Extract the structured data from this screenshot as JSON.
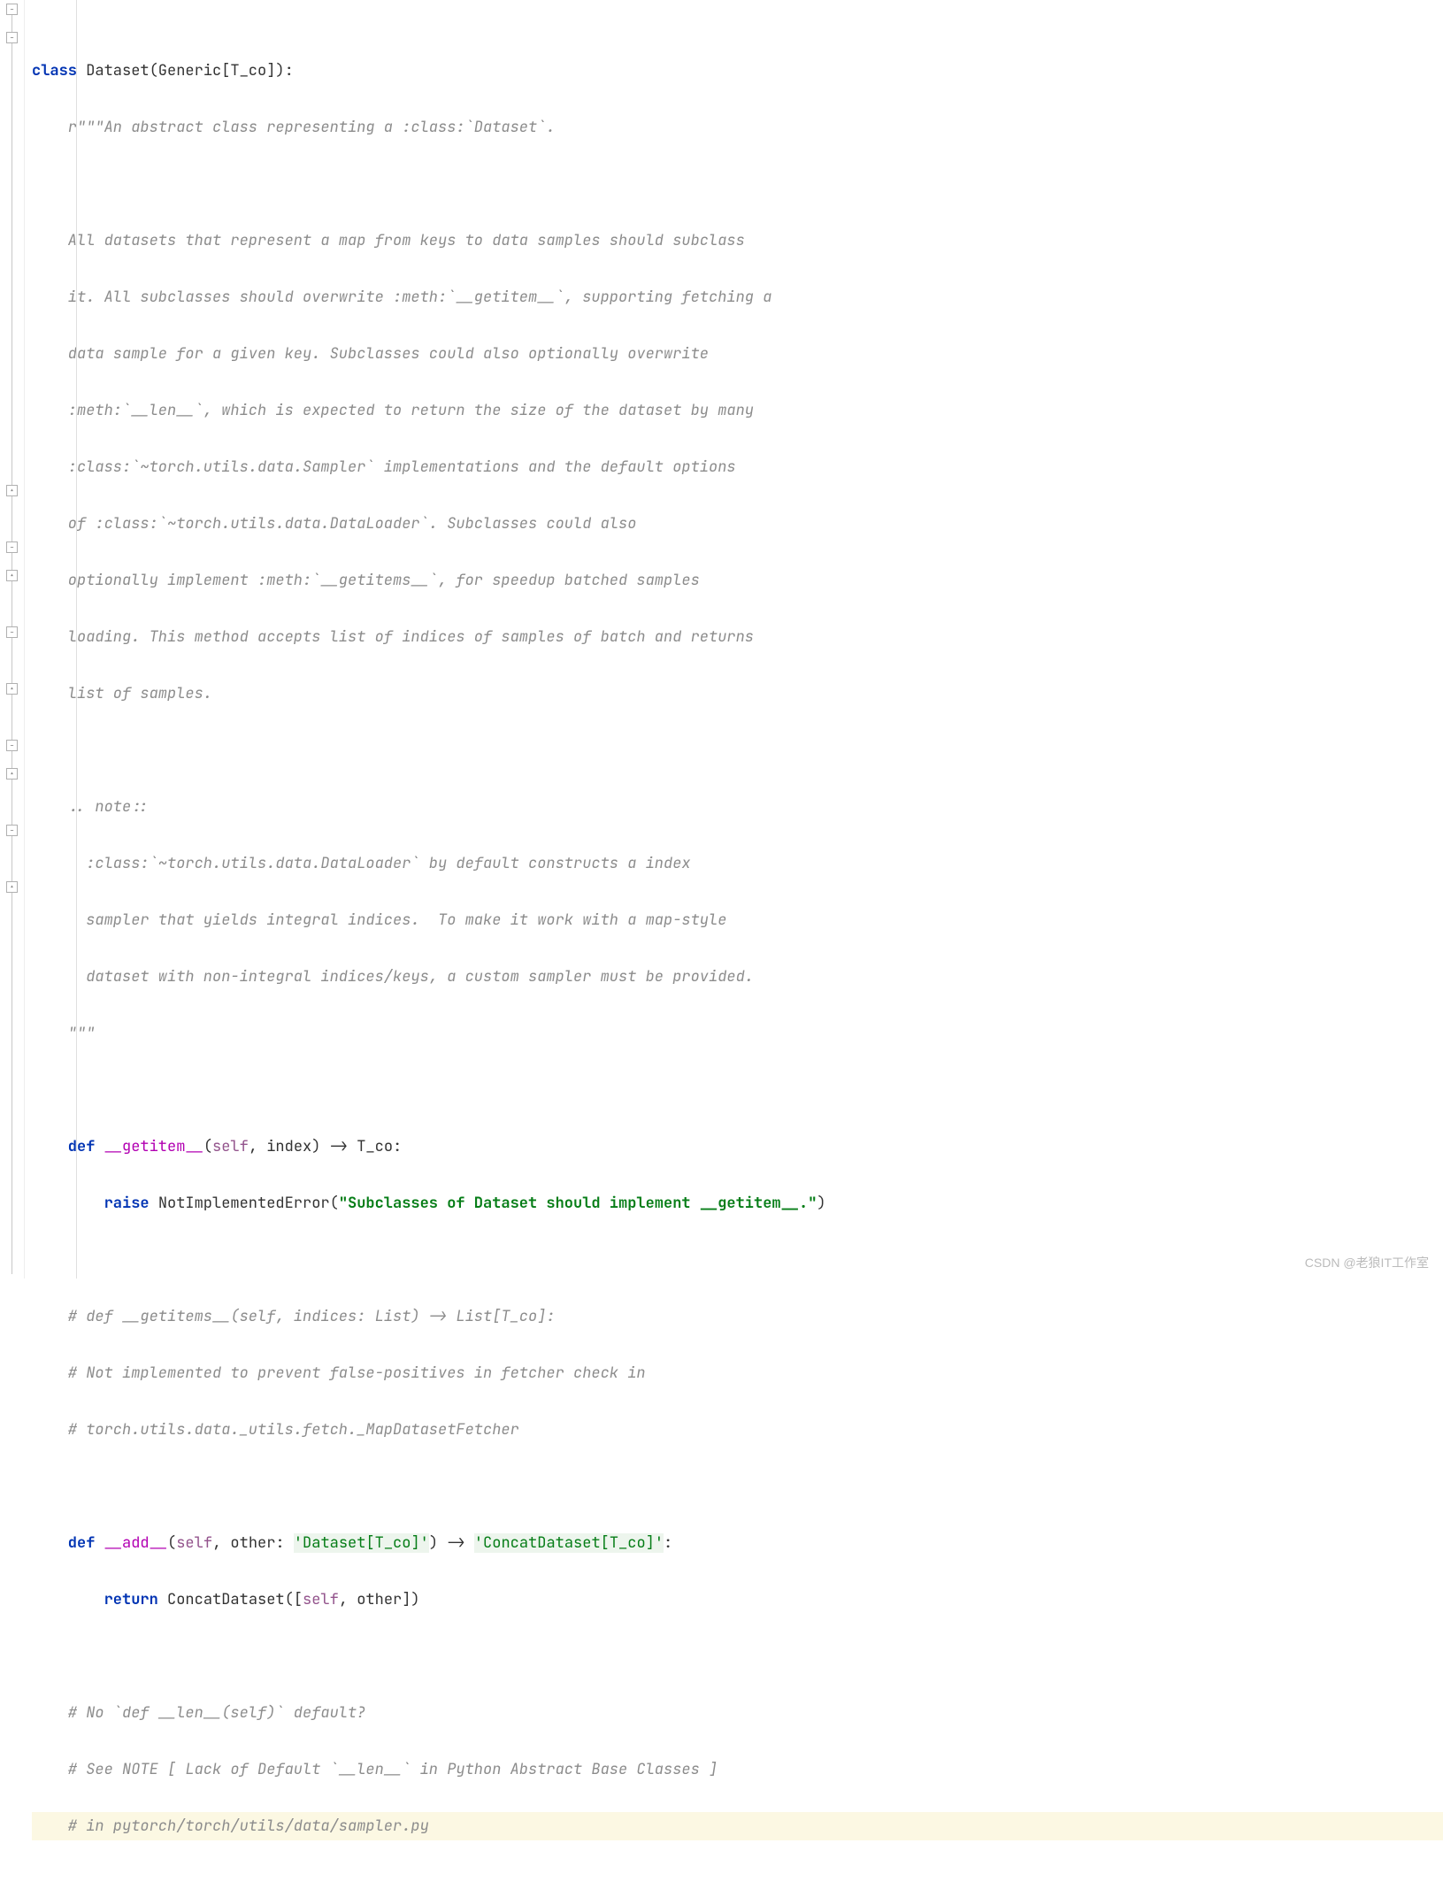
{
  "code": {
    "line1": {
      "kw": "class",
      "name": " Dataset(Generic[T_co]):"
    },
    "doc_open": "    r\"\"\"An abstract class representing a :class:`Dataset`.",
    "doc_blank1": "",
    "doc_l1": "    All datasets that represent a map from keys to data samples should subclass",
    "doc_l2": "    it. All subclasses should overwrite :meth:`__getitem__`, supporting fetching a",
    "doc_l3": "    data sample for a given key. Subclasses could also optionally overwrite",
    "doc_l4": "    :meth:`__len__`, which is expected to return the size of the dataset by many",
    "doc_l5": "    :class:`~torch.utils.data.Sampler` implementations and the default options",
    "doc_l6": "    of :class:`~torch.utils.data.DataLoader`. Subclasses could also",
    "doc_l7": "    optionally implement :meth:`__getitems__`, for speedup batched samples",
    "doc_l8": "    loading. This method accepts list of indices of samples of batch and returns",
    "doc_l9": "    list of samples.",
    "doc_blank2": "",
    "doc_note": "    .. note::",
    "doc_n1": "      :class:`~torch.utils.data.DataLoader` by default constructs a index",
    "doc_n2": "      sampler that yields integral indices.  To make it work with a map-style",
    "doc_n3": "      dataset with non-integral indices/keys, a custom sampler must be provided.",
    "doc_close": "    \"\"\"",
    "blank1": "",
    "getitem": {
      "def": "    def ",
      "name": "__getitem__",
      "sig_open": "(",
      "self": "self",
      "sig_rest": ", index) -> T_co:"
    },
    "raise": {
      "indent": "        ",
      "kw": "raise",
      "sp": " ",
      "err": "NotImplementedError(",
      "msg": "\"Subclasses of Dataset should implement __getitem__.\"",
      "close": ")"
    },
    "blank2": "",
    "c1": "    # def __getitems__(self, indices: List) -> List[T_co]:",
    "c2": "    # Not implemented to prevent false-positives in fetcher check in",
    "c3": "    # torch.utils.data._utils.fetch._MapDatasetFetcher",
    "blank3": "",
    "add": {
      "def": "    def ",
      "name": "__add__",
      "sig_open": "(",
      "self": "self",
      "sig_mid": ", other: ",
      "hint1": "'Dataset[T_co]'",
      "sig_arrow": ") -> ",
      "hint2": "'ConcatDataset[T_co]'",
      "sig_end": ":"
    },
    "return": {
      "indent": "        ",
      "kw": "return",
      "sp": " ",
      "expr_pre": "ConcatDataset([",
      "self": "self",
      "expr_post": ", other])"
    },
    "blank4": "",
    "c4": "    # No `def __len__(self)` default?",
    "c5": "    # See NOTE [ Lack of Default `__len__` in Python Abstract Base Classes ]",
    "c6": "    # in pytorch/torch/utils/data/sampler.py"
  },
  "watermark": "CSDN @老狼IT工作室"
}
